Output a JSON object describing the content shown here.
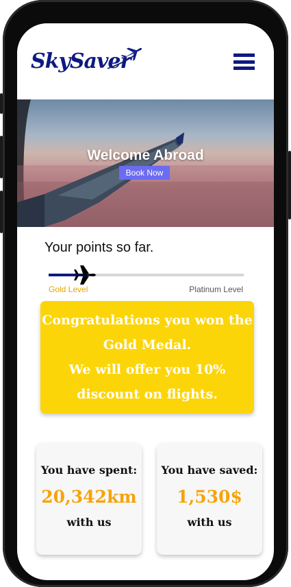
{
  "brand": {
    "name": "SkySaver",
    "color": "#0d1a80"
  },
  "header": {
    "menu_icon": "hamburger-menu-icon"
  },
  "hero": {
    "title": "Welcome Abroad",
    "button_label": "Book Now",
    "button_color": "#6b6cf2"
  },
  "points": {
    "title": "Your points so far.",
    "progress_fraction": 0.2,
    "start_label": "Gold Level",
    "end_label": "Platinum Level",
    "marker_icon": "airplane-icon"
  },
  "congrats": {
    "line1": "Congratulations you won the",
    "line2": "Gold Medal.",
    "line3": "We will offer you 10%",
    "line4": "discount on flights.",
    "color": "#fcd508"
  },
  "stats": {
    "spent": {
      "label": "You have spent:",
      "value": "20,342km",
      "sub": "with us"
    },
    "saved": {
      "label": "You have saved:",
      "value": "1,530$",
      "sub": "with us"
    },
    "value_color": "#f7a30a"
  }
}
